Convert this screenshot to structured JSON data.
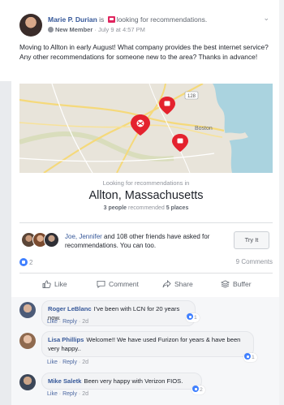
{
  "post": {
    "author": "Marie P. Durian",
    "is_word": "is",
    "activity": "looking for recommendations.",
    "badge": "New Member",
    "time": "· July 9 at 4:57 PM",
    "body": "Moving to Allton in early August! What company provides the best internet service? Any other recommendations for someone new to the area? Thanks in advance!"
  },
  "map": {
    "labels": {
      "city": "Boston",
      "route": "128"
    }
  },
  "recommendation": {
    "kicker": "Looking for recommendations in",
    "city": "Allton, Massachusetts",
    "people_count": "3 people",
    "recommended_word": "recommended",
    "places_count": "5 places"
  },
  "friends": {
    "names": "Joe, Jennifer",
    "text": "and 108 other friends have asked for recommendations. You can too.",
    "button": "Try It"
  },
  "stats": {
    "likes": "2",
    "comments": "9 Comments"
  },
  "actions": {
    "like": "Like",
    "comment": "Comment",
    "share": "Share",
    "buffer": "Buffer"
  },
  "comments": [
    {
      "name": "Roger LeBlanc",
      "text": "I've been with LCN for 20 years now.",
      "like": "Like",
      "reply": "Reply",
      "age": "2d",
      "reactions": "1"
    },
    {
      "name": "Lisa Phillips",
      "text": "Welcome!! We have used Furizon for years & have been very happy..",
      "like": "Like",
      "reply": "Reply",
      "age": "2d",
      "reactions": "1"
    },
    {
      "name": "Mike Saletk",
      "text": "Been very happy with Verizon FIOS.",
      "like": "Like",
      "reply": "Reply",
      "age": "2d",
      "reactions": "2"
    }
  ],
  "colors": {
    "link": "#365899",
    "marker": "#e4222e",
    "like_blue": "#4080ff"
  }
}
